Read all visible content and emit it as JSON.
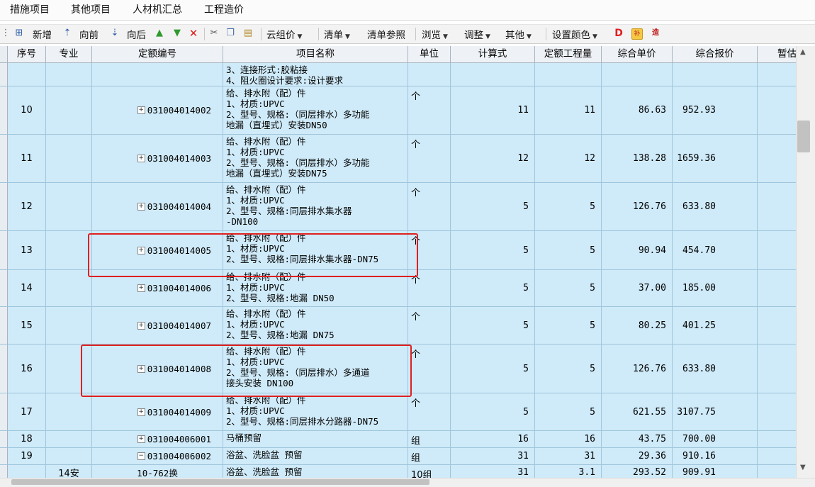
{
  "tabs": [
    "措施项目",
    "其他项目",
    "人材机汇总",
    "工程造价"
  ],
  "toolbar": {
    "new": "新增",
    "forward": "向前",
    "backward": "向后",
    "cloud_group": "云组价",
    "list": "清单",
    "list_ref": "清单参照",
    "browse": "浏览",
    "adjust": "调整",
    "other": "其他",
    "set_color": "设置颜色",
    "d_label": "D",
    "fu_label": "补",
    "zao_label": "造"
  },
  "columns": {
    "seq": "序号",
    "major": "专业",
    "code": "定额编号",
    "name": "项目名称",
    "unit": "单位",
    "formula": "计算式",
    "quota_qty": "定额工程量",
    "unit_price": "综合单价",
    "total_price": "综合报价",
    "provisional": "暂估"
  },
  "rows": [
    {
      "seq": "",
      "major": "",
      "code": "",
      "expand": "",
      "name": [
        "3、连接形式:胶粘接",
        "4、阻火圈设计要求:设计要求"
      ],
      "unit": "",
      "formula": "",
      "qty": "",
      "price": "",
      "total": ""
    },
    {
      "seq": "10",
      "major": "",
      "code": "031004014002",
      "expand": "⊞",
      "name": [
        "给、排水附（配）件",
        "1、材质:UPVC",
        "2、型号、规格:（同层排水）多功能",
        "地漏（直埋式）安装DN50"
      ],
      "unit": "个",
      "formula": "11",
      "qty": "11",
      "price": "86.63",
      "total": "952.93"
    },
    {
      "seq": "11",
      "major": "",
      "code": "031004014003",
      "expand": "⊞",
      "name": [
        "给、排水附（配）件",
        "1、材质:UPVC",
        "2、型号、规格:（同层排水）多功能",
        "地漏（直埋式）安装DN75"
      ],
      "unit": "个",
      "formula": "12",
      "qty": "12",
      "price": "138.28",
      "total": "1659.36"
    },
    {
      "seq": "12",
      "major": "",
      "code": "031004014004",
      "expand": "⊞",
      "name": [
        "给、排水附（配）件",
        "1、材质:UPVC",
        "2、型号、规格:同层排水集水器",
        "-DN100"
      ],
      "unit": "个",
      "formula": "5",
      "qty": "5",
      "price": "126.76",
      "total": "633.80"
    },
    {
      "seq": "13",
      "major": "",
      "code": "031004014005",
      "expand": "⊞",
      "name": [
        "给、排水附（配）件",
        "1、材质:UPVC",
        "2、型号、规格:同层排水集水器-DN75"
      ],
      "unit": "个",
      "formula": "5",
      "qty": "5",
      "price": "90.94",
      "total": "454.70"
    },
    {
      "seq": "14",
      "major": "",
      "code": "031004014006",
      "expand": "⊞",
      "name": [
        "给、排水附（配）件",
        "1、材质:UPVC",
        "2、型号、规格:地漏 DN50"
      ],
      "unit": "个",
      "formula": "5",
      "qty": "5",
      "price": "37.00",
      "total": "185.00"
    },
    {
      "seq": "15",
      "major": "",
      "code": "031004014007",
      "expand": "⊞",
      "name": [
        "给、排水附（配）件",
        "1、材质:UPVC",
        "2、型号、规格:地漏 DN75"
      ],
      "unit": "个",
      "formula": "5",
      "qty": "5",
      "price": "80.25",
      "total": "401.25"
    },
    {
      "seq": "16",
      "major": "",
      "code": "031004014008",
      "expand": "⊞",
      "name": [
        "给、排水附（配）件",
        "1、材质:UPVC",
        "2、型号、规格:（同层排水）多通道",
        "接头安装 DN100"
      ],
      "unit": "个",
      "formula": "5",
      "qty": "5",
      "price": "126.76",
      "total": "633.80"
    },
    {
      "seq": "17",
      "major": "",
      "code": "031004014009",
      "expand": "⊞",
      "name": [
        "给、排水附（配）件",
        "1、材质:UPVC",
        "2、型号、规格:同层排水分路器-DN75"
      ],
      "unit": "个",
      "formula": "5",
      "qty": "5",
      "price": "621.55",
      "total": "3107.75"
    },
    {
      "seq": "18",
      "major": "",
      "code": "031004006001",
      "expand": "⊞",
      "name": [
        "马桶预留"
      ],
      "unit": "组",
      "formula": "16",
      "qty": "16",
      "price": "43.75",
      "total": "700.00"
    },
    {
      "seq": "19",
      "major": "",
      "code": "031004006002",
      "expand": "⊟",
      "name": [
        "浴盆、洗脸盆 预留"
      ],
      "unit": "组",
      "formula": "31",
      "qty": "31",
      "price": "29.36",
      "total": "910.16"
    },
    {
      "seq": "",
      "major": "14安",
      "code": "10-762换",
      "expand": "",
      "name": [
        "浴盆、洗脸盆 预留"
      ],
      "unit": "10组",
      "formula": "31",
      "qty": "3.1",
      "price": "293.52",
      "total": "909.91"
    }
  ]
}
